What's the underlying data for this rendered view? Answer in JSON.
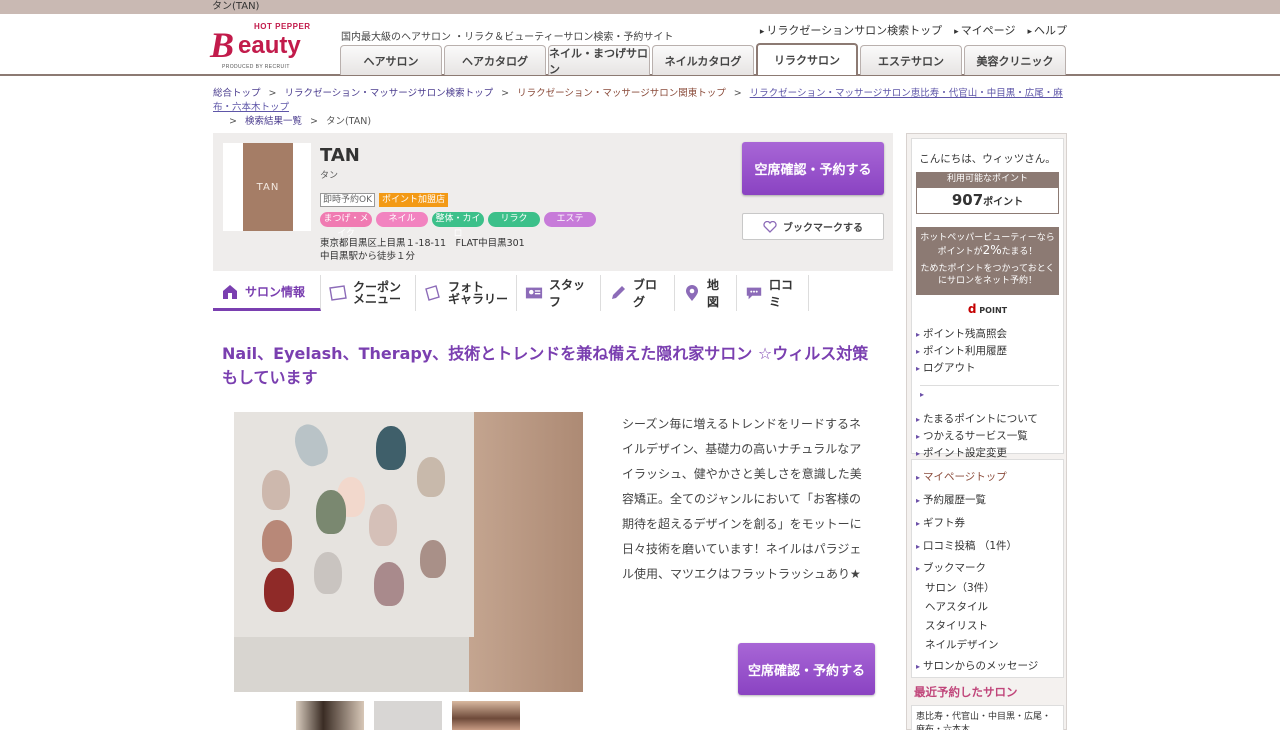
{
  "window": {
    "tab_title": "タン(TAN)"
  },
  "header": {
    "logo_top": "HOT PEPPER",
    "logo_b": "B",
    "logo_rest": "eauty",
    "logo_produced": "PRODUCED BY RECRUIT",
    "tagline": "国内最大級のヘアサロン ・リラク＆ビューティーサロン検索・予約サイト",
    "top_links": [
      "リラクゼーションサロン検索トップ",
      "マイページ",
      "ヘルプ"
    ],
    "nav_tabs": [
      "ヘアサロン",
      "ヘアカタログ",
      "ネイル・まつげサロン",
      "ネイルカタログ",
      "リラクサロン",
      "エステサロン",
      "美容クリニック"
    ],
    "active_tab": "リラクサロン"
  },
  "breadcrumb": {
    "items": [
      "総合トップ",
      "リラクゼーション・マッサージサロン検索トップ",
      "リラクゼーション・マッサージサロン関東トップ",
      "リラクゼーション・マッサージサロン恵比寿・代官山・中目黒・広尾・麻布・六本木トップ"
    ],
    "search_results": "検索結果一覧",
    "current": "タン(TAN)",
    "sep": ">"
  },
  "salon": {
    "thumb_text": "TAN",
    "name": "TAN",
    "kana": "タン",
    "badge_instant": "即時予約OK",
    "badge_points": "ポイント加盟店",
    "categories": [
      {
        "label": "まつげ・メイク",
        "color": "#f07bb2"
      },
      {
        "label": "ネイル",
        "color": "#f283c0"
      },
      {
        "label": "整体・カイロ",
        "color": "#3cc08a"
      },
      {
        "label": "リラク",
        "color": "#3cc08a"
      },
      {
        "label": "エステ",
        "color": "#c77bd9"
      }
    ],
    "address": "東京都目黒区上目黒１-18-11　FLAT中目黒301",
    "access": "中目黒駅から徒歩１分",
    "reserve_label": "空席確認・予約する",
    "bookmark_label": "ブックマークする"
  },
  "subnav": {
    "tabs": [
      "サロン情報",
      "クーポン",
      "メニュー",
      "フォト",
      "ギャラリー",
      "スタッフ",
      "ブログ",
      "地図",
      "口コミ"
    ]
  },
  "content": {
    "headline": "Nail、Eyelash、Therapy、技術とトレンドを兼ね備えた隠れ家サロン ☆ウィルス対策もしています",
    "description": "シーズン毎に増えるトレンドをリードするネイルデザイン、基礎力の高いナチュラルなアイラッシュ、健やかさと美しさを意識した美容矯正。全てのジャンルにおいて「お客様の期待を超えるデザインを創る」をモットーに日々技術を磨いています！ネイルはパラジェル使用、マツエクはフラットラッシュあり★",
    "reserve_label": "空席確認・予約する"
  },
  "sidebar": {
    "greeting": "こんにちは、ウィッツさん。",
    "points_label": "利用可能なポイント",
    "points_value": "907",
    "points_unit": "ポイント",
    "promo_line1": "ホットペッパービューティーなら",
    "promo_line2a": "ポイントが",
    "promo_rate": "2%",
    "promo_line2b": "たまる！",
    "promo_line3": "ためたポイントをつかっておとく",
    "promo_line4": "にサロンをネット予約！",
    "dpoint_d": "d",
    "dpoint_label": "POINT",
    "links1": [
      "ポイント残高照会",
      "ポイント利用履歴",
      "ログアウト"
    ],
    "links2": [
      "たまるポイントについて",
      "つかえるサービス一覧",
      "ポイント設定変更"
    ],
    "mypage_links": [
      "マイページトップ",
      "予約履歴一覧",
      "ギフト券",
      "口コミ投稿 （1件）",
      "ブックマーク"
    ],
    "bookmark_sub": [
      "サロン（3件）",
      "ヘアスタイル",
      "スタイリスト",
      "ネイルデザイン"
    ],
    "messages": "サロンからのメッセージ",
    "recent_title": "最近予約したサロン",
    "recent_area": "恵比寿・代官山・中目黒・広尾・麻布・六本木"
  }
}
